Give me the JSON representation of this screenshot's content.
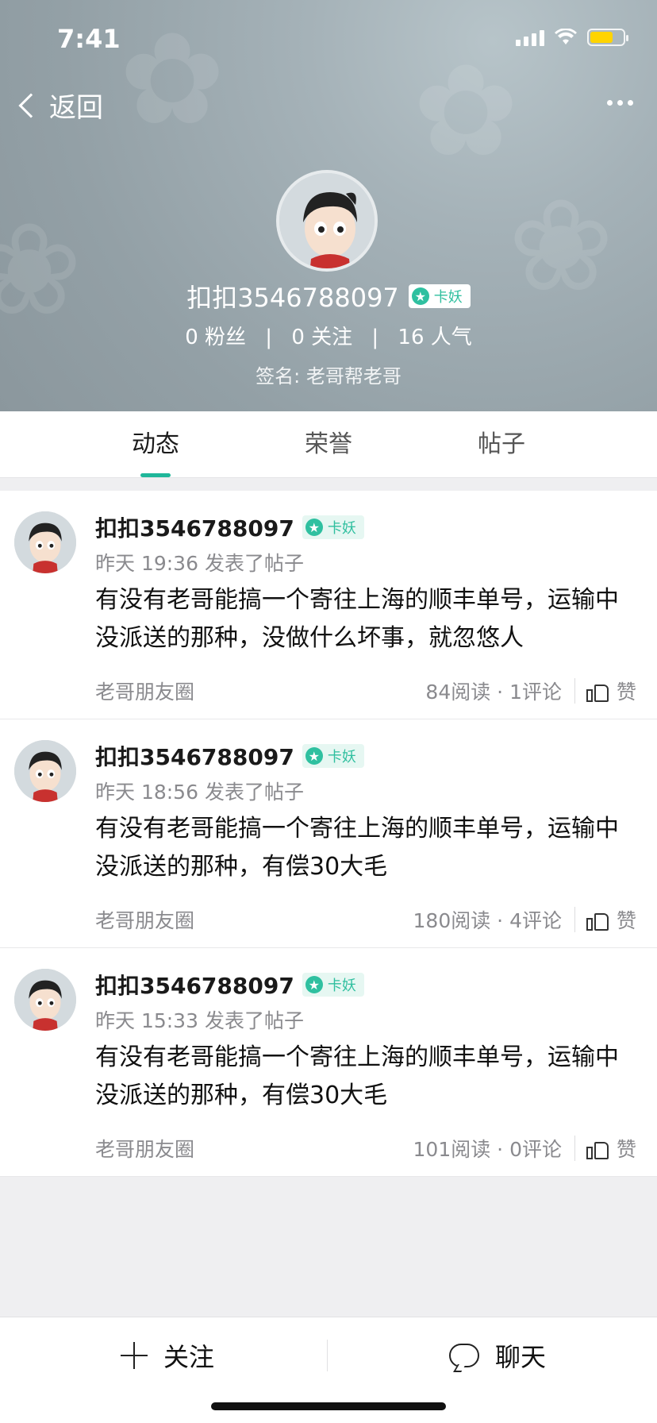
{
  "status": {
    "time": "7:41"
  },
  "nav": {
    "back_label": "返回"
  },
  "profile": {
    "name": "扣扣3546788097",
    "badge_label": "卡妖",
    "fans": "0 粉丝",
    "following": "0 关注",
    "popularity": "16 人气",
    "signature": "签名: 老哥帮老哥"
  },
  "tabs": [
    {
      "label": "动态",
      "active": true
    },
    {
      "label": "荣誉",
      "active": false
    },
    {
      "label": "帖子",
      "active": false
    }
  ],
  "posts": [
    {
      "author": "扣扣3546788097",
      "badge": "卡妖",
      "time": "昨天 19:36 发表了帖子",
      "content": "有没有老哥能搞一个寄往上海的顺丰单号，运输中没派送的那种，没做什么坏事，就忽悠人",
      "source": "老哥朋友圈",
      "counts": "84阅读 · 1评论",
      "like_label": "赞"
    },
    {
      "author": "扣扣3546788097",
      "badge": "卡妖",
      "time": "昨天 18:56 发表了帖子",
      "content": "有没有老哥能搞一个寄往上海的顺丰单号，运输中没派送的那种，有偿30大毛",
      "source": "老哥朋友圈",
      "counts": "180阅读 · 4评论",
      "like_label": "赞"
    },
    {
      "author": "扣扣3546788097",
      "badge": "卡妖",
      "time": "昨天 15:33 发表了帖子",
      "content": " 有没有老哥能搞一个寄往上海的顺丰单号，运输中没派送的那种，有偿30大毛",
      "source": "老哥朋友圈",
      "counts": "101阅读 · 0评论",
      "like_label": "赞"
    }
  ],
  "bottom": {
    "follow_label": "关注",
    "chat_label": "聊天"
  },
  "colors": {
    "accent": "#1fb79a",
    "header_bg": "#9aa7ad"
  }
}
